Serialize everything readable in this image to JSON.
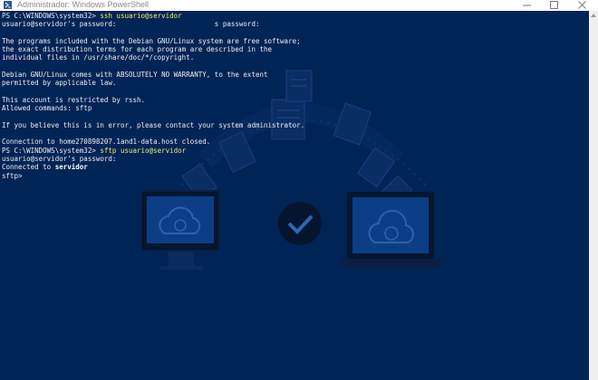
{
  "window": {
    "title": "Administrador: Windows PowerShell",
    "icon": "powershell-icon"
  },
  "console": {
    "background": "#012456",
    "text_color": "#eeedf0",
    "command_color": "#f4ea6b",
    "lines": [
      {
        "prompt": "PS C:\\WINDOWS\\system32> ",
        "command": "ssh usuario@servidor"
      },
      {
        "text": "usuario@servidor's password:                        s password:"
      },
      {
        "text": ""
      },
      {
        "text": "The programs included with the Debian GNU/Linux system are free software;"
      },
      {
        "text": "the exact distribution terms for each program are described in the"
      },
      {
        "text": "individual files in /usr/share/doc/*/copyright."
      },
      {
        "text": ""
      },
      {
        "text": "Debian GNU/Linux comes with ABSOLUTELY NO WARRANTY, to the extent"
      },
      {
        "text": "permitted by applicable law."
      },
      {
        "text": ""
      },
      {
        "text": "This account is restricted by rssh."
      },
      {
        "text": "Allowed commands: sftp"
      },
      {
        "text": ""
      },
      {
        "text": "If you believe this is in error, please contact your system administrator."
      },
      {
        "text": ""
      },
      {
        "text": "Connection to home270898207.1and1-data.host closed."
      },
      {
        "prompt": "PS C:\\WINDOWS\\system32> ",
        "command": "sftp usuario@servidor"
      },
      {
        "text": "usuario@servidor's password:"
      },
      {
        "text": "Connected to ",
        "bold": "servidor"
      },
      {
        "text": "sftp>"
      }
    ]
  }
}
